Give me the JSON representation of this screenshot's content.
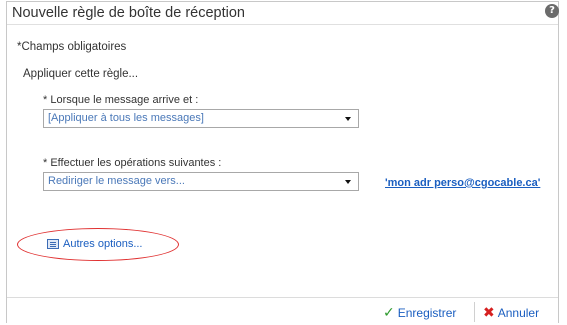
{
  "dialog": {
    "title": "Nouvelle règle de boîte de réception",
    "help_icon": "?"
  },
  "required_note": "*Champs obligatoires",
  "apply_rule_label": "Appliquer cette règle...",
  "condition": {
    "label": "* Lorsque le message arrive et :",
    "selected": "[Appliquer à tous les messages]"
  },
  "action": {
    "label": "* Effectuer les opérations suivantes :",
    "selected": "Rediriger le message vers...",
    "recipient_link": "'mon adr perso@cgocable.ca'"
  },
  "more_options": {
    "label": "Autres options...",
    "icon": "list-icon",
    "highlight_color": "#e03030"
  },
  "footer": {
    "save_label": "Enregistrer",
    "save_icon": "check-icon",
    "cancel_label": "Annuler",
    "cancel_icon": "x-icon"
  },
  "colors": {
    "link": "#1a5ec0",
    "check": "#2e9a2e",
    "cancel_x": "#d62020"
  }
}
